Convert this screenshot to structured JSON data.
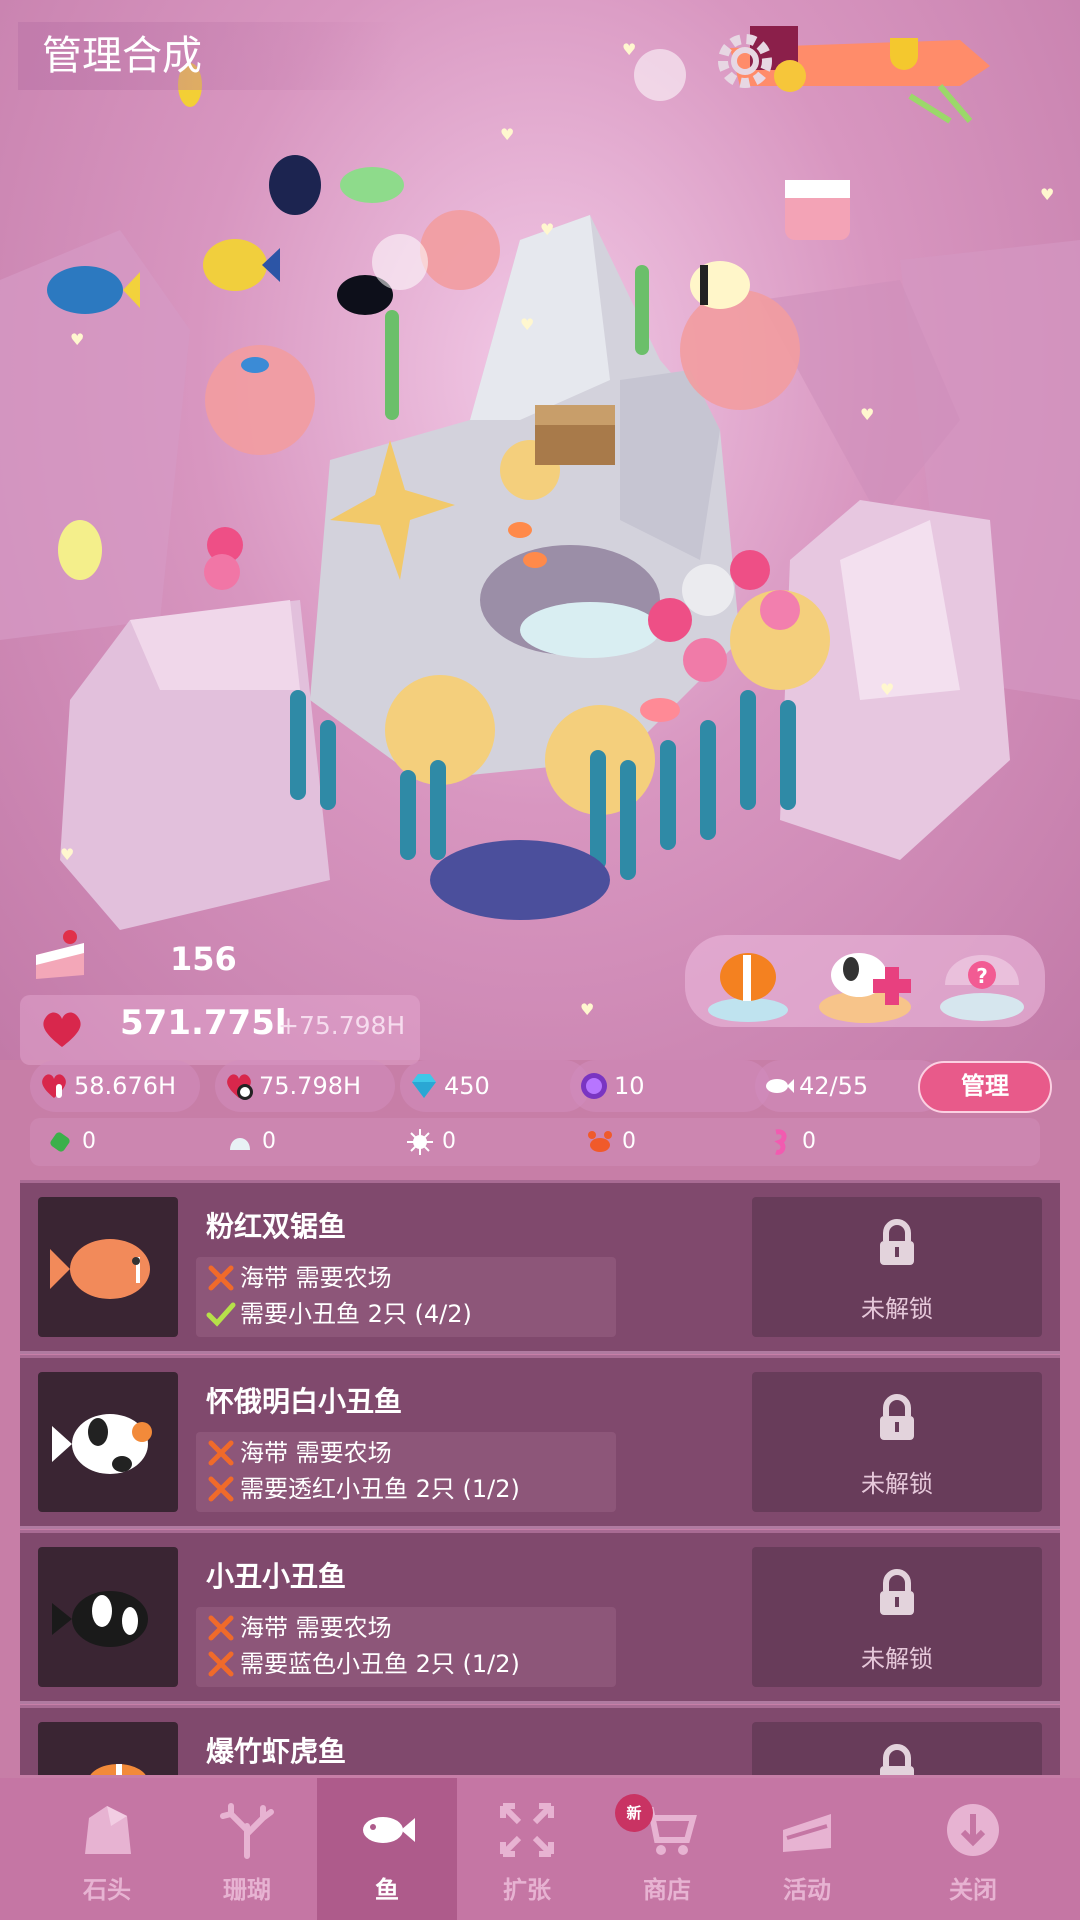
{
  "header": {
    "title": "管理合成"
  },
  "resources": {
    "cakes": "156",
    "love_total": "571.775l",
    "love_rate": "+75.798H",
    "stats": [
      {
        "icon": "tap-heart-icon",
        "value": "58.676H"
      },
      {
        "icon": "timer-heart-icon",
        "value": "75.798H"
      },
      {
        "icon": "diamond-icon",
        "value": "450"
      },
      {
        "icon": "pearl-icon",
        "value": "10"
      },
      {
        "icon": "fish-count-icon",
        "value": "42/55"
      }
    ],
    "manage_label": "管理",
    "materials": [
      {
        "icon": "seaweed-icon",
        "value": "0"
      },
      {
        "icon": "shell-icon",
        "value": "0"
      },
      {
        "icon": "urchin-icon",
        "value": "0"
      },
      {
        "icon": "crab-icon",
        "value": "0"
      },
      {
        "icon": "seahorse-icon",
        "value": "0"
      }
    ]
  },
  "fish_list": [
    {
      "name": "粉红双锯鱼",
      "requirements": [
        {
          "met": false,
          "text": "海带 需要农场"
        },
        {
          "met": true,
          "text": "需要小丑鱼 2只 (4/2)"
        }
      ],
      "status": "未解锁"
    },
    {
      "name": "怀俄明白小丑鱼",
      "requirements": [
        {
          "met": false,
          "text": "海带 需要农场"
        },
        {
          "met": false,
          "text": "需要透红小丑鱼 2只 (1/2)"
        }
      ],
      "status": "未解锁"
    },
    {
      "name": "小丑小丑鱼",
      "requirements": [
        {
          "met": false,
          "text": "海带 需要农场"
        },
        {
          "met": false,
          "text": "需要蓝色小丑鱼 2只 (1/2)"
        }
      ],
      "status": "未解锁"
    },
    {
      "name": "爆竹虾虎鱼",
      "requirements": [],
      "status": ""
    }
  ],
  "nav": {
    "items": [
      {
        "label": "石头",
        "icon": "rock-icon"
      },
      {
        "label": "珊瑚",
        "icon": "coral-icon"
      },
      {
        "label": "鱼",
        "icon": "fish-icon"
      },
      {
        "label": "扩张",
        "icon": "expand-icon"
      },
      {
        "label": "商店",
        "icon": "cart-icon"
      },
      {
        "label": "活动",
        "icon": "cake-slice-icon"
      },
      {
        "label": "关闭",
        "icon": "close-down-icon"
      }
    ],
    "active": "鱼",
    "new_badge": "新"
  },
  "colors": {
    "accent": "#e85a8a",
    "card_bg": "#80496d",
    "nav_bg": "#c576a4",
    "check": "#b6e04a",
    "cross": "#f06a2a"
  }
}
